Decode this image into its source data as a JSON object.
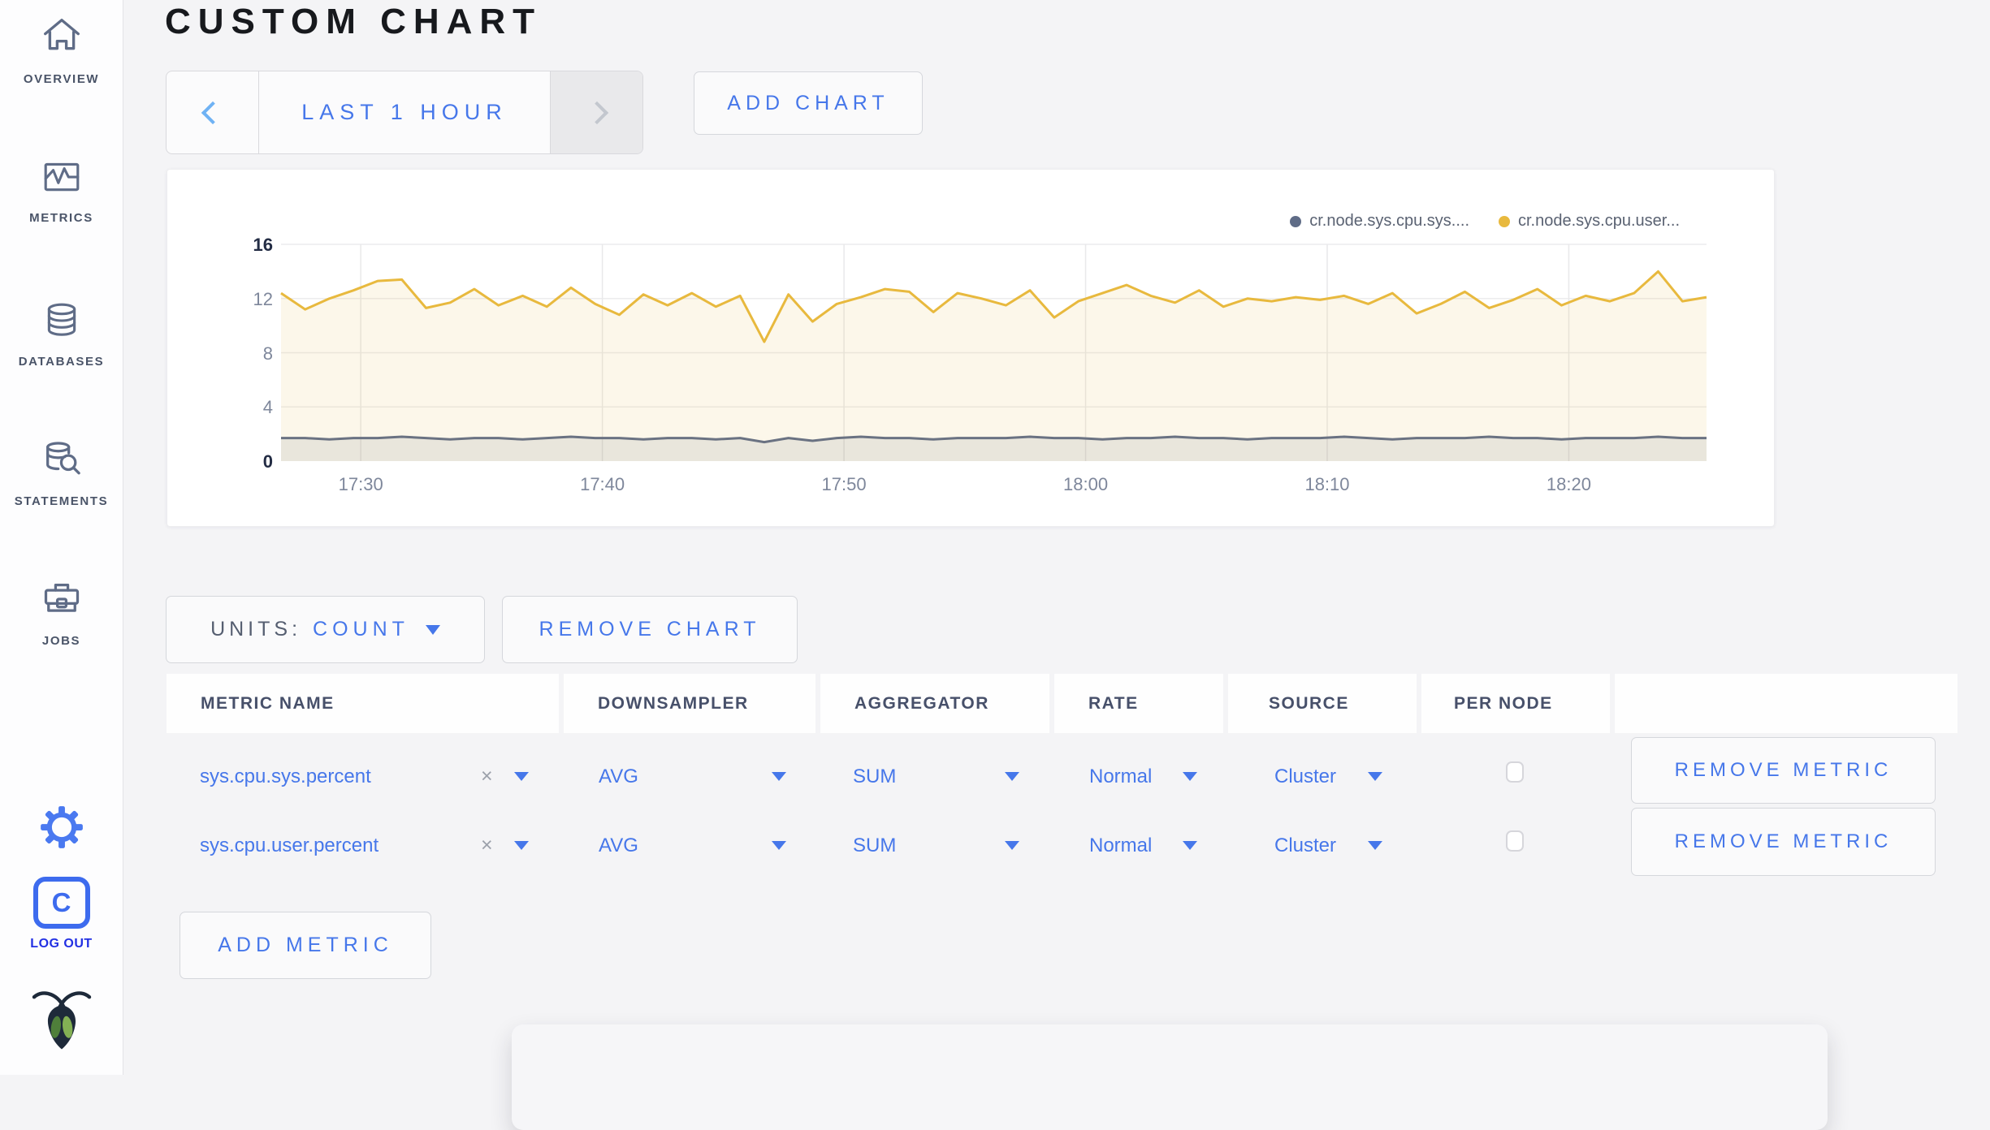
{
  "sidebar": {
    "items": [
      {
        "label": "OVERVIEW",
        "icon": "home-icon"
      },
      {
        "label": "METRICS",
        "icon": "metrics-icon"
      },
      {
        "label": "DATABASES",
        "icon": "database-icon"
      },
      {
        "label": "STATEMENTS",
        "icon": "statements-icon"
      },
      {
        "label": "JOBS",
        "icon": "jobs-icon"
      }
    ],
    "settings_icon": "gear-icon",
    "logout_label": "LOG OUT",
    "logo_icon": "cockroachdb-logo"
  },
  "header": {
    "title": "CUSTOM CHART"
  },
  "time_picker": {
    "label": "LAST 1 HOUR",
    "prev_icon": "chevron-left-icon",
    "next_icon": "chevron-right-icon",
    "next_disabled": true
  },
  "add_chart_label": "ADD CHART",
  "chart_data": {
    "type": "line",
    "title": "",
    "grid": true,
    "legend_position": "top-right",
    "x_axis": {
      "tick_labels": [
        "17:30",
        "17:40",
        "17:50",
        "18:00",
        "18:10",
        "18:20"
      ],
      "tick_minutes": [
        3.3,
        13.3,
        23.3,
        33.3,
        43.3,
        53.3
      ],
      "span_minutes": 59
    },
    "y_axis": {
      "ticks": [
        0,
        4,
        8,
        12,
        16
      ],
      "ylim": [
        0,
        16
      ]
    },
    "series": [
      {
        "name": "cr.node.sys.cpu.sys....",
        "color": "#6A7282",
        "dot_color": "#5F6C87",
        "values": [
          1.7,
          1.7,
          1.6,
          1.7,
          1.7,
          1.8,
          1.7,
          1.6,
          1.7,
          1.7,
          1.6,
          1.7,
          1.8,
          1.7,
          1.7,
          1.6,
          1.7,
          1.7,
          1.6,
          1.7,
          1.4,
          1.7,
          1.5,
          1.7,
          1.8,
          1.7,
          1.7,
          1.6,
          1.7,
          1.7,
          1.7,
          1.8,
          1.7,
          1.7,
          1.6,
          1.7,
          1.7,
          1.8,
          1.7,
          1.7,
          1.6,
          1.7,
          1.7,
          1.7,
          1.8,
          1.7,
          1.6,
          1.7,
          1.7,
          1.7,
          1.8,
          1.7,
          1.7,
          1.6,
          1.7,
          1.7,
          1.7,
          1.8,
          1.7,
          1.7
        ]
      },
      {
        "name": "cr.node.sys.cpu.user...",
        "color": "#E8B93E",
        "dot_color": "#E8B93E",
        "values": [
          12.4,
          11.2,
          12.0,
          12.6,
          13.3,
          13.4,
          11.3,
          11.7,
          12.7,
          11.5,
          12.2,
          11.4,
          12.8,
          11.6,
          10.8,
          12.3,
          11.5,
          12.4,
          11.4,
          12.2,
          8.8,
          12.3,
          10.3,
          11.6,
          12.1,
          12.7,
          12.5,
          11.0,
          12.4,
          12.0,
          11.5,
          12.6,
          10.6,
          11.8,
          12.4,
          13.0,
          12.2,
          11.7,
          12.6,
          11.4,
          12.0,
          11.8,
          12.1,
          11.9,
          12.2,
          11.6,
          12.4,
          10.9,
          11.6,
          12.5,
          11.3,
          11.9,
          12.7,
          11.5,
          12.2,
          11.8,
          12.4,
          14.0,
          11.8,
          12.1
        ]
      }
    ]
  },
  "units_bar": {
    "units_label": "UNITS:",
    "units_value": "COUNT",
    "remove_chart_label": "REMOVE CHART"
  },
  "metrics_table": {
    "headers": [
      "METRIC NAME",
      "DOWNSAMPLER",
      "AGGREGATOR",
      "RATE",
      "SOURCE",
      "PER NODE"
    ],
    "rows": [
      {
        "metric_name": "sys.cpu.sys.percent",
        "clear_icon": "×",
        "downsampler": "AVG",
        "aggregator": "SUM",
        "rate": "Normal",
        "source": "Cluster",
        "per_node_checked": false,
        "remove_label": "REMOVE METRIC"
      },
      {
        "metric_name": "sys.cpu.user.percent",
        "clear_icon": "×",
        "downsampler": "AVG",
        "aggregator": "SUM",
        "rate": "Normal",
        "source": "Cluster",
        "per_node_checked": false,
        "remove_label": "REMOVE METRIC"
      }
    ]
  },
  "add_metric_label": "ADD METRIC",
  "colors": {
    "accent_blue": "#4677EA",
    "light_blue_chevron": "#6FB2F4",
    "disabled_chevron": "#C3C7CE",
    "series_yellow": "#E8B93E",
    "series_gray": "#6A7282",
    "logout_blue": "#2230E3",
    "sidebar_icon": "#5F6C87",
    "page_bg": "#F4F4F6"
  }
}
